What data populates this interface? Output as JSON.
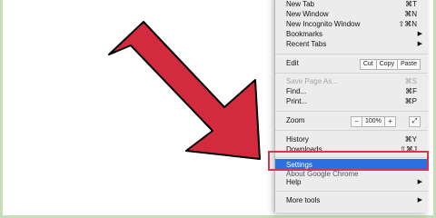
{
  "menu": {
    "group1": [
      {
        "label": "New Tab",
        "shortcut": "⌘T"
      },
      {
        "label": "New Window",
        "shortcut": "⌘N"
      },
      {
        "label": "New Incognito Window",
        "shortcut": "⇧⌘N"
      },
      {
        "label": "Bookmarks"
      },
      {
        "label": "Recent Tabs"
      }
    ],
    "edit": {
      "label": "Edit",
      "cut": "Cut",
      "copy": "Copy",
      "paste": "Paste"
    },
    "group2": [
      {
        "label": "Save Page As...",
        "shortcut": "⌘S"
      },
      {
        "label": "Find...",
        "shortcut": "⌘F"
      },
      {
        "label": "Print...",
        "shortcut": "⌘P"
      }
    ],
    "zoom": {
      "label": "Zoom",
      "minus": "−",
      "value": "100%",
      "plus": "+",
      "fullscreen": "⤢"
    },
    "group3": [
      {
        "label": "History",
        "shortcut": "⌘Y"
      },
      {
        "label": "Downloads",
        "shortcut": "⇧⌘J"
      }
    ],
    "settings": {
      "label": "Settings"
    },
    "about": {
      "label": "About Google Chrome"
    },
    "help": {
      "label": "Help"
    },
    "more_tools": {
      "label": "More tools"
    },
    "submenu_indicator": "▶"
  },
  "colors": {
    "arrow": "#d42a3d",
    "highlight_box": "#d9364c",
    "selection": "#2b6fe3"
  }
}
